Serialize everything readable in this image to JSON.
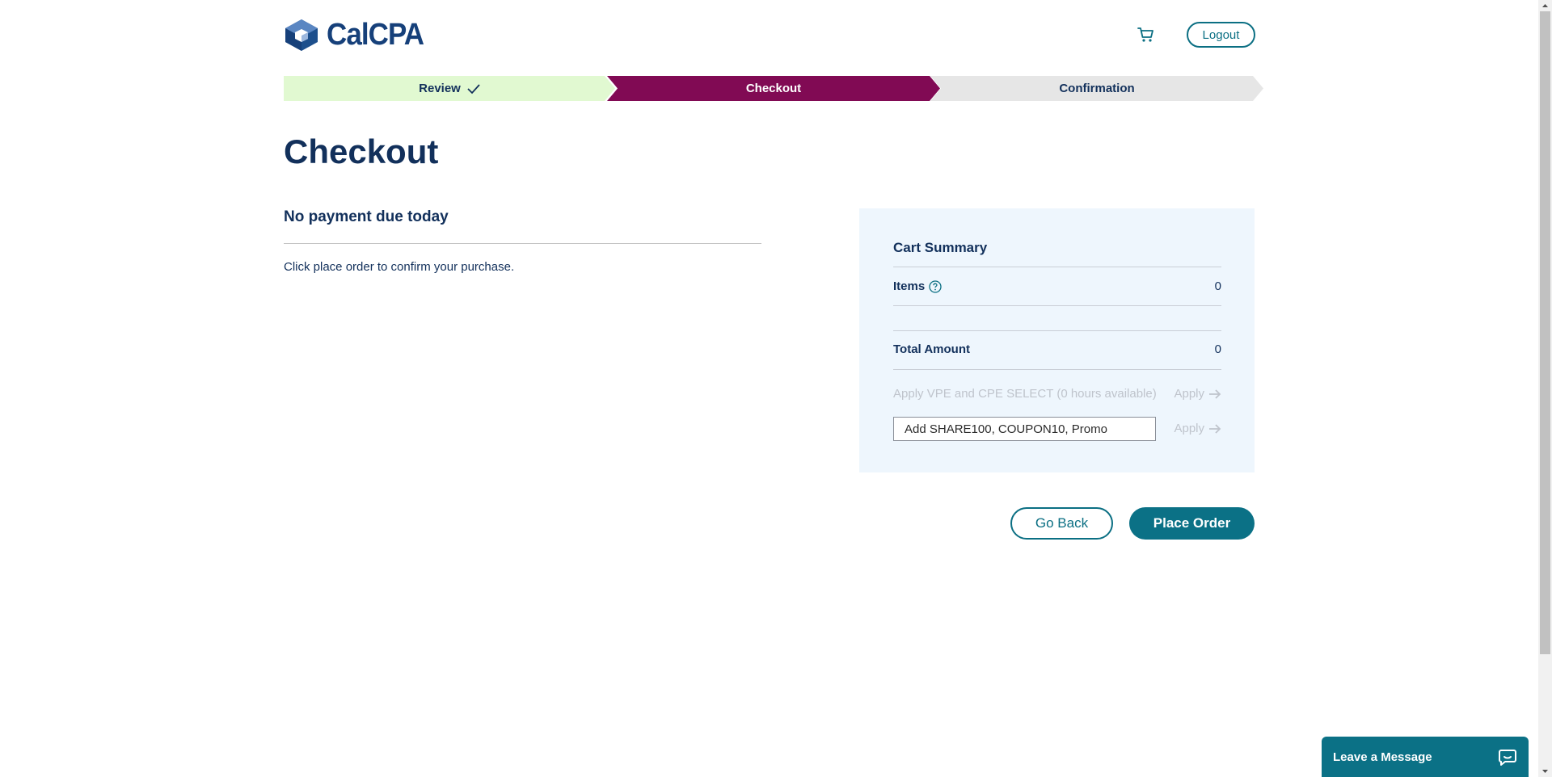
{
  "header": {
    "logo_text": "CalCPA",
    "cart_icon": "cart-icon",
    "logout_label": "Logout"
  },
  "stepper": {
    "steps": [
      {
        "label": "Review",
        "state": "completed"
      },
      {
        "label": "Checkout",
        "state": "active"
      },
      {
        "label": "Confirmation",
        "state": "pending"
      }
    ]
  },
  "page": {
    "title": "Checkout"
  },
  "payment": {
    "heading": "No payment due today",
    "instruction": "Click place order to confirm your purchase."
  },
  "summary": {
    "title": "Cart Summary",
    "items_label": "Items",
    "items_value": "0",
    "total_label": "Total Amount",
    "total_value": "0",
    "vpe_label": "Apply VPE and CPE SELECT (0 hours available)",
    "apply_label": "Apply",
    "promo_placeholder": "Add SHARE100, COUPON10, Promo"
  },
  "actions": {
    "go_back_label": "Go Back",
    "place_order_label": "Place Order"
  },
  "chat": {
    "label": "Leave a Message"
  },
  "colors": {
    "primary_teal": "#0b7186",
    "navy": "#12305b",
    "review_bg": "#e1f9d1",
    "checkout_bg": "#810a54",
    "confirm_bg": "#e6e6e6",
    "summary_bg": "#eef6fd"
  }
}
